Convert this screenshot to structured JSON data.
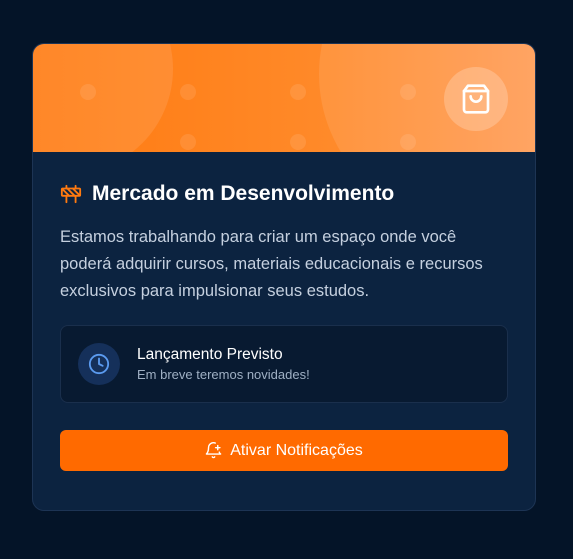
{
  "card": {
    "title": "Mercado em Desenvolvimento",
    "title_icon": "construction-barrier-icon",
    "banner_icon": "shopping-bag-icon",
    "description": "Estamos trabalhando para criar um espaço onde você poderá adquirir cursos, materiais educacionais e recursos exclusivos para impulsionar seus estudos.",
    "launch": {
      "icon": "clock-icon",
      "title": "Lançamento Previsto",
      "subtitle": "Em breve teremos novidades!"
    },
    "button": {
      "icon": "bell-plus-icon",
      "label": "Ativar Notificações"
    }
  },
  "colors": {
    "page_background": "#041428",
    "card_background": "#0c2340",
    "accent": "#ff6a00",
    "banner_gradient_start": "#ff7a10",
    "banner_gradient_end": "#ff9a52"
  }
}
